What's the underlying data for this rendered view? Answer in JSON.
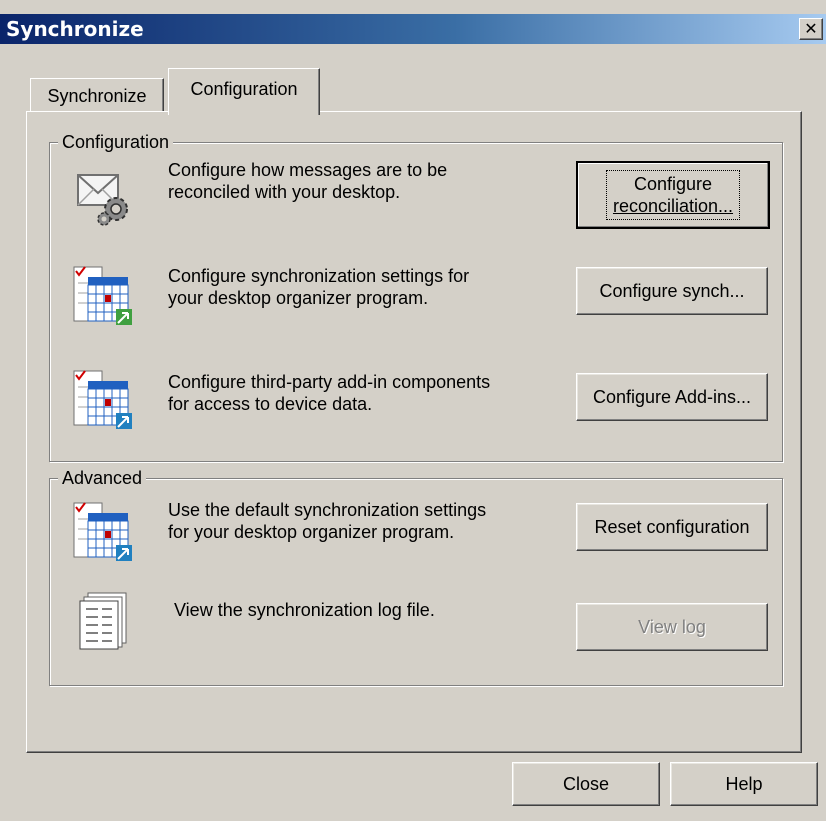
{
  "window": {
    "title": "Synchronize",
    "close_glyph": "✕"
  },
  "tabs": [
    {
      "label": "Synchronize",
      "selected": false
    },
    {
      "label": "Configuration",
      "selected": true
    }
  ],
  "configuration_group": {
    "legend": "Configuration",
    "rows": [
      {
        "icon": "envelope-gear-icon",
        "line1": "Configure how messages are to be",
        "line2": "reconciled with your desktop.",
        "button_line1": "Configure",
        "button_line2": "reconciliation..."
      },
      {
        "icon": "calendar-sync-icon",
        "line1": "Configure synchronization settings for",
        "line2": "your desktop organizer program.",
        "button": "Configure synch..."
      },
      {
        "icon": "calendar-sync-icon",
        "line1": "Configure third-party add-in components",
        "line2": "for access to device data.",
        "button": "Configure Add-ins..."
      }
    ]
  },
  "advanced_group": {
    "legend": "Advanced",
    "rows": [
      {
        "icon": "calendar-sync-icon",
        "line1": "Use the default synchronization settings",
        "line2": "for your desktop organizer program.",
        "button": "Reset configuration"
      },
      {
        "icon": "log-file-icon",
        "line1": "View the synchronization log file.",
        "button": "View log",
        "button_disabled": true
      }
    ]
  },
  "footer": {
    "close": "Close",
    "help": "Help"
  }
}
